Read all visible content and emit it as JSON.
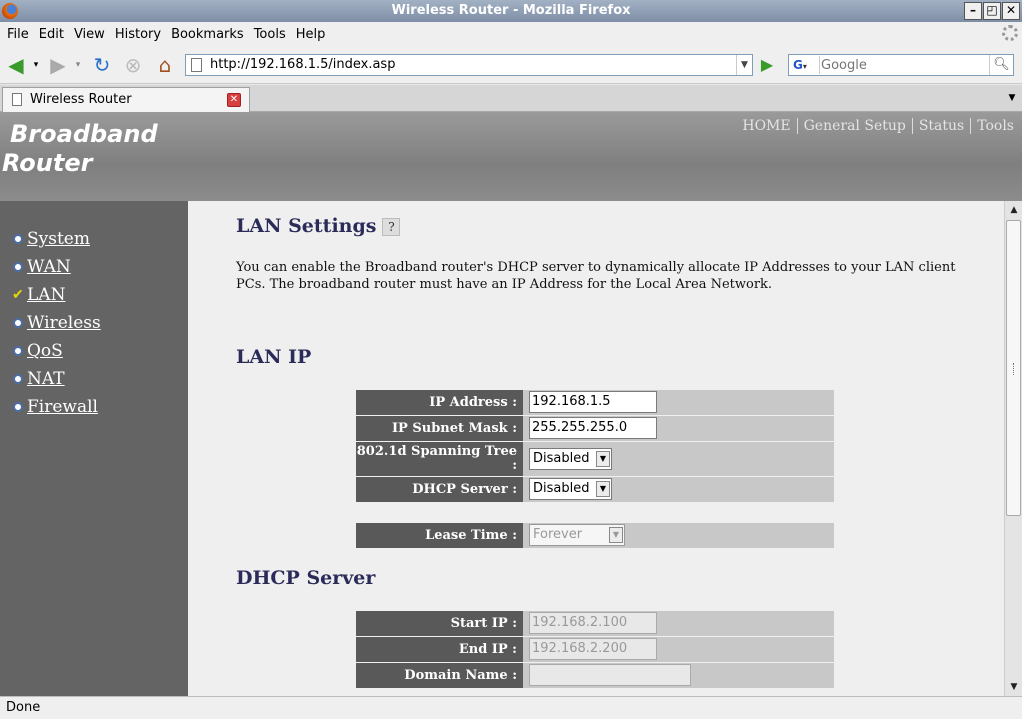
{
  "window": {
    "title": "Wireless Router - Mozilla Firefox",
    "minimize": "–",
    "restore": "◰",
    "close": "✕"
  },
  "menu": [
    {
      "label": "File"
    },
    {
      "label": "Edit"
    },
    {
      "label": "View"
    },
    {
      "label": "History"
    },
    {
      "label": "Bookmarks"
    },
    {
      "label": "Tools"
    },
    {
      "label": "Help"
    }
  ],
  "toolbar": {
    "url": "http://192.168.1.5/index.asp",
    "search_engine": "G",
    "search_placeholder": "Google"
  },
  "tabs": [
    {
      "label": "Wireless Router"
    }
  ],
  "banner": {
    "brand_line1": "Broadband",
    "brand_line2": "Router",
    "nav": [
      {
        "label": "HOME"
      },
      {
        "label": "General Setup"
      },
      {
        "label": "Status"
      },
      {
        "label": "Tools"
      }
    ]
  },
  "sidebar": {
    "items": [
      {
        "label": "System",
        "active": false
      },
      {
        "label": "WAN",
        "active": false
      },
      {
        "label": "LAN",
        "active": true
      },
      {
        "label": "Wireless",
        "active": false
      },
      {
        "label": "QoS",
        "active": false
      },
      {
        "label": "NAT",
        "active": false
      },
      {
        "label": "Firewall",
        "active": false
      }
    ]
  },
  "content": {
    "title": "LAN Settings",
    "help_glyph": "?",
    "intro": "You can enable the Broadband router's DHCP server to dynamically allocate IP Addresses to your LAN client PCs. The broadband router must have an IP Address for the Local Area Network.",
    "lan_ip_title": "LAN IP",
    "lan_ip": {
      "ip_label": "IP Address :",
      "ip_value": "192.168.1.5",
      "mask_label": "IP Subnet Mask :",
      "mask_value": "255.255.255.0",
      "stp_label": "802.1d Spanning Tree :",
      "stp_value": "Disabled",
      "dhcp_label": "DHCP Server :",
      "dhcp_value": "Disabled"
    },
    "lease": {
      "label": "Lease Time :",
      "value": "Forever"
    },
    "dhcp_title": "DHCP Server",
    "dhcp": {
      "start_label": "Start IP :",
      "start_value": "192.168.2.100",
      "end_label": "End IP :",
      "end_value": "192.168.2.200",
      "domain_label": "Domain Name :",
      "domain_value": ""
    }
  },
  "status": {
    "text": "Done"
  },
  "colors": {
    "accent": "#2b2b5a",
    "sidebar": "#646464",
    "label_bg": "#595959"
  }
}
